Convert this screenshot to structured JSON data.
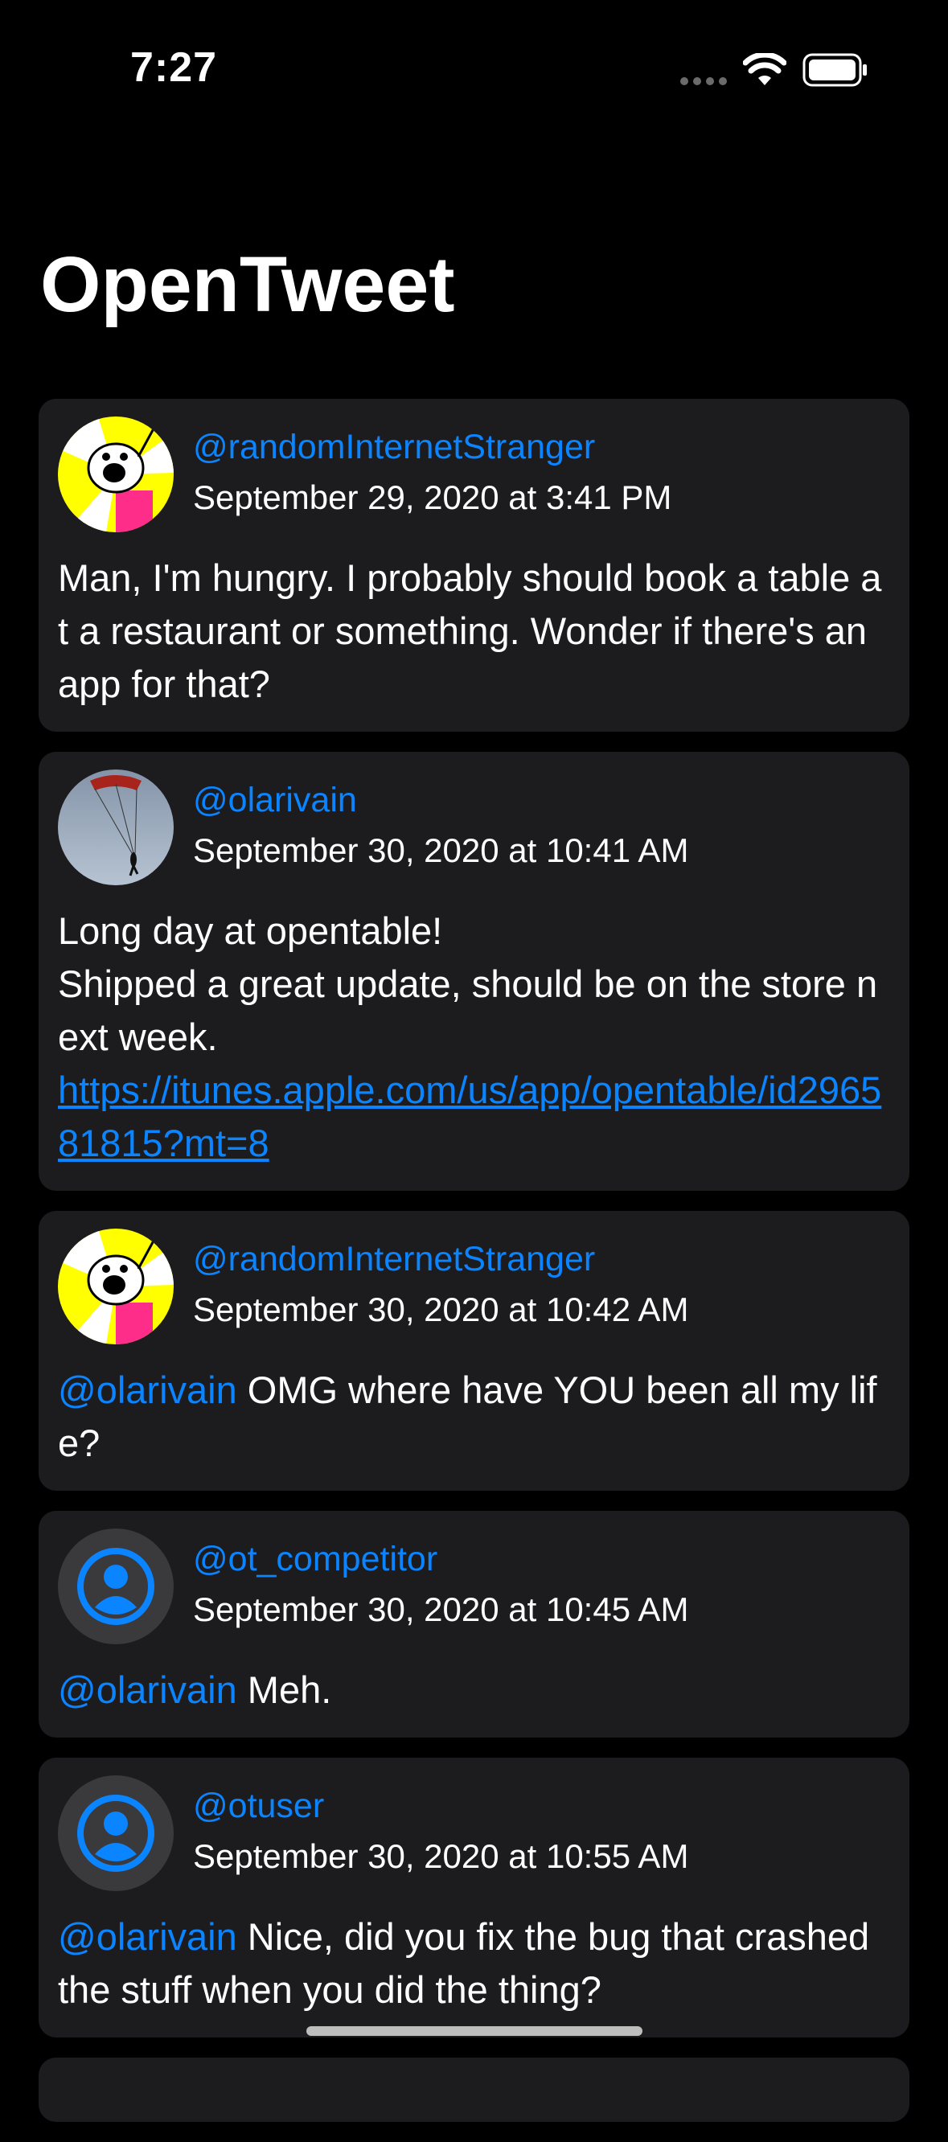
{
  "status_bar": {
    "time": "7:27"
  },
  "header": {
    "title": "OpenTweet"
  },
  "tweets": [
    {
      "handle": "@randomInternetStranger",
      "timestamp": "September 29, 2020 at 3:41 PM",
      "avatar": "cartoon-avatar-icon",
      "text": "Man, I'm hungry. I probably should book a table at a restaurant or something. Wonder if there's an app for that?"
    },
    {
      "handle": "@olarivain",
      "timestamp": "September 30, 2020 at 10:41 AM",
      "avatar": "paraglider-photo",
      "text": "Long day at opentable!\nShipped a great update, should be on the store next week.",
      "link": "https://itunes.apple.com/us/app/opentable/id296581815?mt=8"
    },
    {
      "handle": "@randomInternetStranger",
      "timestamp": "September 30, 2020 at 10:42 AM",
      "avatar": "cartoon-avatar-icon",
      "mention": "@olarivain",
      "text": " OMG where have YOU been all my life?"
    },
    {
      "handle": "@ot_competitor",
      "timestamp": "September 30, 2020 at 10:45 AM",
      "avatar": "person-circle-icon",
      "mention": "@olarivain",
      "text": " Meh."
    },
    {
      "handle": "@otuser",
      "timestamp": "September 30, 2020 at 10:55 AM",
      "avatar": "person-circle-icon",
      "mention": "@olarivain",
      "text": " Nice, did you fix the bug that crashed the stuff when you did the thing?"
    }
  ],
  "colors": {
    "accent": "#0a84ff",
    "card": "#1c1c1e",
    "background": "#000000"
  }
}
